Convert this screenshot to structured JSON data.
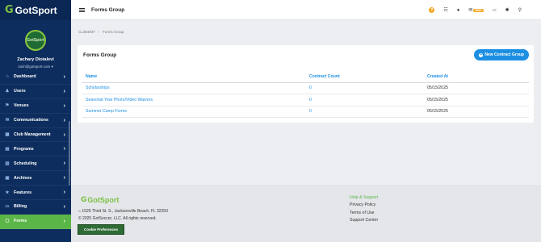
{
  "brand": {
    "name": "GotSport",
    "mark": "G"
  },
  "user": {
    "avatar_text": "GotSport",
    "name": "Zachary Diotalevi",
    "email": "zach@gotsport.com"
  },
  "sidebar": {
    "items": [
      {
        "label": "Dashboard",
        "icon": "dashboard-icon",
        "glyph": "⌂"
      },
      {
        "label": "Users",
        "icon": "users-icon",
        "glyph": "♟"
      },
      {
        "label": "Venues",
        "icon": "venues-icon",
        "glyph": "⚑"
      },
      {
        "label": "Communications",
        "icon": "communications-icon",
        "glyph": "✉"
      },
      {
        "label": "Club Management",
        "icon": "club-management-icon",
        "glyph": "▦"
      },
      {
        "label": "Programs",
        "icon": "programs-icon",
        "glyph": "▤"
      },
      {
        "label": "Scheduling",
        "icon": "scheduling-icon",
        "glyph": "▥"
      },
      {
        "label": "Archives",
        "icon": "archives-icon",
        "glyph": "▣"
      },
      {
        "label": "Features",
        "icon": "features-icon",
        "glyph": "★"
      },
      {
        "label": "Billing",
        "icon": "billing-icon",
        "glyph": "▭"
      },
      {
        "label": "Forms",
        "icon": "forms-icon",
        "glyph": "▢",
        "active": true
      }
    ]
  },
  "header": {
    "title": "Forms Group",
    "inbox_badge": "999+"
  },
  "breadcrumb": {
    "org_id": "CL384837",
    "current": "Forms Group"
  },
  "card": {
    "title": "Forms Group",
    "new_button": "New Contract Group",
    "columns": [
      "Name",
      "Contract Count",
      "Created At"
    ],
    "rows": [
      {
        "name": "Scholarships",
        "count": "0",
        "created": "05/15/2025"
      },
      {
        "name": "Seasonal Year Photo/Video Waivers",
        "count": "0",
        "created": "05/15/2025"
      },
      {
        "name": "Summer Camp Forms",
        "count": "0",
        "created": "05/15/2025"
      }
    ]
  },
  "footer": {
    "address": "1529 Third St. S., Jacksonville Beach, FL 32250",
    "copyright": "© 2025 GotSoccer, LLC. All rights reserved.",
    "cookie_button": "Cookie Preferences",
    "links": [
      "Help & Support",
      "Privacy Policy",
      "Terms of Use",
      "Support Center"
    ]
  },
  "colors": {
    "sidebar": "#0d2d5e",
    "accent_green": "#5ab646",
    "link_blue": "#1d8fe2",
    "badge_orange": "#f5a623"
  }
}
